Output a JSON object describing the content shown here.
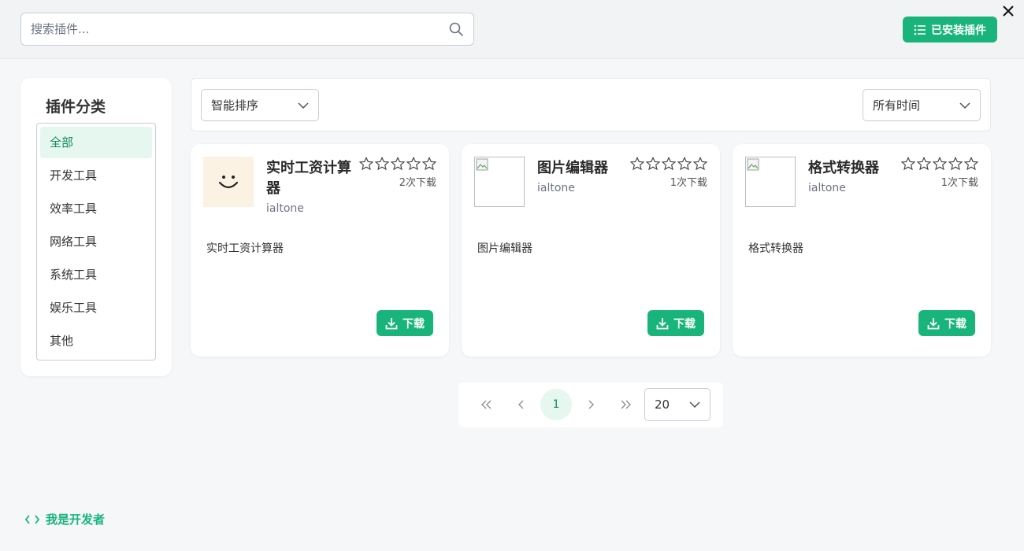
{
  "search": {
    "placeholder": "搜索插件..."
  },
  "header": {
    "installed_label": "已安装插件"
  },
  "sidebar": {
    "title": "插件分类",
    "items": [
      {
        "label": "全部",
        "active": true
      },
      {
        "label": "开发工具"
      },
      {
        "label": "效率工具"
      },
      {
        "label": "网络工具"
      },
      {
        "label": "系统工具"
      },
      {
        "label": "娱乐工具"
      },
      {
        "label": "其他"
      }
    ]
  },
  "filters": {
    "sort": "智能排序",
    "time": "所有时间"
  },
  "plugins": [
    {
      "name": "实时工资计算器",
      "author": "ialtone",
      "downloads": "2次下载",
      "description": "实时工资计算器",
      "rating": 0,
      "icon": "smile-icon"
    },
    {
      "name": "图片编辑器",
      "author": "ialtone",
      "downloads": "1次下载",
      "description": "图片编辑器",
      "rating": 0,
      "icon": "broken-image-icon"
    },
    {
      "name": "格式转换器",
      "author": "ialtone",
      "downloads": "1次下载",
      "description": "格式转换器",
      "rating": 0,
      "icon": "broken-image-icon"
    }
  ],
  "download_label": "下载",
  "pagination": {
    "current_page": "1",
    "page_size": "20"
  },
  "footer": {
    "developer_label": "我是开发者"
  },
  "colors": {
    "accent": "#18b47b",
    "active_bg": "#e6f7ef"
  }
}
